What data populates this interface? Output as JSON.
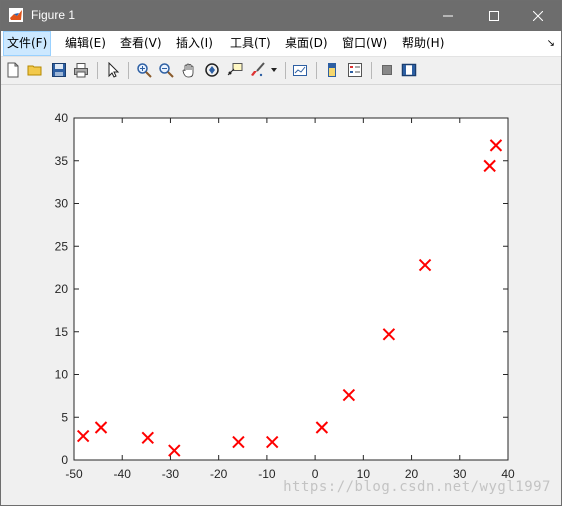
{
  "window": {
    "title": "Figure 1",
    "titlebar_color": "#6d6d6d"
  },
  "menu": {
    "items": [
      "文件(F)",
      "编辑(E)",
      "查看(V)",
      "插入(I)",
      "工具(T)",
      "桌面(D)",
      "窗口(W)",
      "帮助(H)"
    ],
    "more_glyph": "↘"
  },
  "toolbar": {
    "buttons": [
      "new-figure-icon",
      "open-file-icon",
      "save-icon",
      "print-icon",
      "edit-plot-pointer-icon",
      "zoom-in-icon",
      "zoom-out-icon",
      "pan-hand-icon",
      "rotate-3d-icon",
      "data-cursor-icon",
      "brush-icon",
      "brush-dropdown-icon",
      "link-plot-icon",
      "insert-colorbar-icon",
      "insert-legend-icon",
      "hide-plot-tools-icon",
      "show-plot-tools-icon"
    ]
  },
  "chart_data": {
    "type": "scatter",
    "title": "",
    "xlabel": "",
    "ylabel": "",
    "xlim": [
      -50,
      40
    ],
    "ylim": [
      0,
      40
    ],
    "xticks": [
      -50,
      -40,
      -30,
      -20,
      -10,
      0,
      10,
      20,
      30,
      40
    ],
    "yticks": [
      0,
      5,
      10,
      15,
      20,
      25,
      30,
      35,
      40
    ],
    "marker": "x",
    "marker_color": "#ff0000",
    "grid": false,
    "points": [
      {
        "x": -48.1,
        "y": 2.8
      },
      {
        "x": -44.4,
        "y": 3.8
      },
      {
        "x": -34.7,
        "y": 2.6
      },
      {
        "x": -29.2,
        "y": 1.1
      },
      {
        "x": -15.9,
        "y": 2.1
      },
      {
        "x": -8.9,
        "y": 2.1
      },
      {
        "x": 1.4,
        "y": 3.8
      },
      {
        "x": 7.0,
        "y": 7.6
      },
      {
        "x": 15.3,
        "y": 14.7
      },
      {
        "x": 22.8,
        "y": 22.8
      },
      {
        "x": 36.2,
        "y": 34.4
      },
      {
        "x": 37.5,
        "y": 36.8
      }
    ]
  },
  "watermark": "https://blog.csdn.net/wygl1997"
}
